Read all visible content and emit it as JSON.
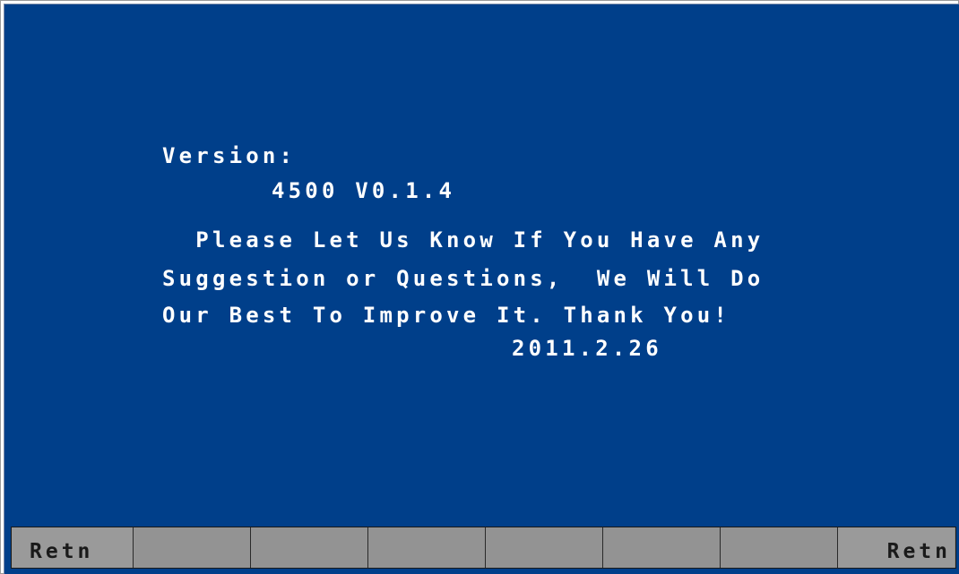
{
  "about": {
    "version_label": "Version:",
    "version_value": "4500 V0.1.4",
    "message_lines": [
      "  Please Let Us Know If You Have Any",
      "Suggestion or Questions,  We Will Do",
      "Our Best To Improve It. Thank You!"
    ],
    "date": "2011.2.26"
  },
  "softkeys": [
    {
      "label": "Retn"
    },
    {
      "label": ""
    },
    {
      "label": ""
    },
    {
      "label": ""
    },
    {
      "label": ""
    },
    {
      "label": ""
    },
    {
      "label": ""
    },
    {
      "label": "Retn"
    }
  ],
  "colors": {
    "background": "#003f8a",
    "text": "#ffffff",
    "softkey_bg": "#939393"
  }
}
